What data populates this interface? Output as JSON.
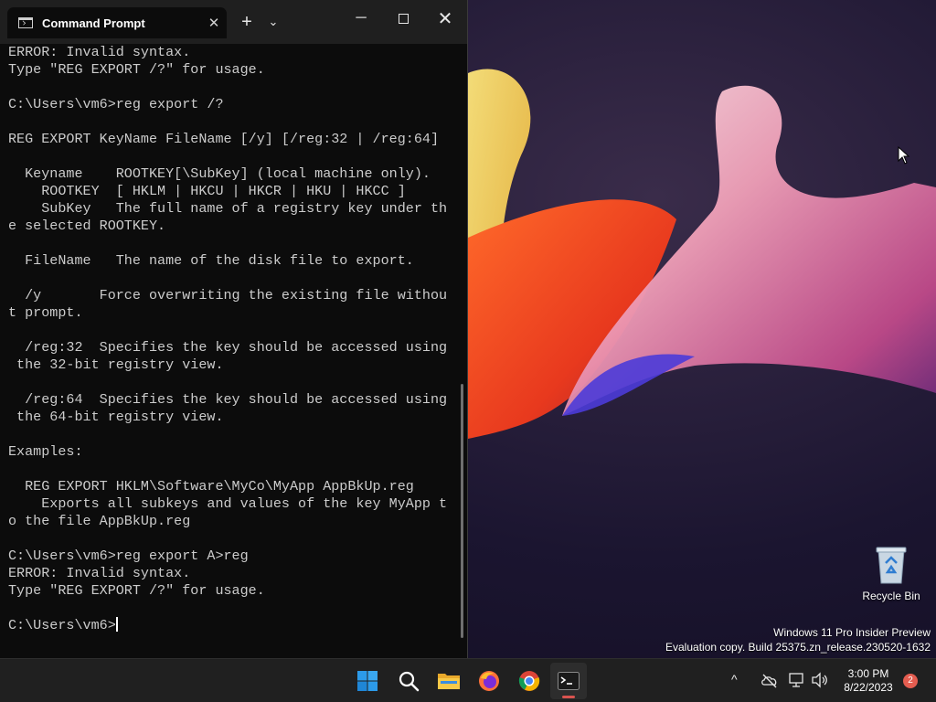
{
  "window": {
    "tab_title": "Command Prompt",
    "tab_close": "✕",
    "new_tab": "+",
    "dropdown": "⌄",
    "minimize": "─",
    "close": "✕"
  },
  "console_lines": [
    "ERROR: Invalid syntax.",
    "Type \"REG EXPORT /?\" for usage.",
    "",
    "C:\\Users\\vm6>reg export /?",
    "",
    "REG EXPORT KeyName FileName [/y] [/reg:32 | /reg:64]",
    "",
    "  Keyname    ROOTKEY[\\SubKey] (local machine only).",
    "    ROOTKEY  [ HKLM | HKCU | HKCR | HKU | HKCC ]",
    "    SubKey   The full name of a registry key under th",
    "e selected ROOTKEY.",
    "",
    "  FileName   The name of the disk file to export.",
    "",
    "  /y       Force overwriting the existing file withou",
    "t prompt.",
    "",
    "  /reg:32  Specifies the key should be accessed using",
    " the 32-bit registry view.",
    "",
    "  /reg:64  Specifies the key should be accessed using",
    " the 64-bit registry view.",
    "",
    "Examples:",
    "",
    "  REG EXPORT HKLM\\Software\\MyCo\\MyApp AppBkUp.reg",
    "    Exports all subkeys and values of the key MyApp t",
    "o the file AppBkUp.reg",
    "",
    "C:\\Users\\vm6>reg export A>reg",
    "ERROR: Invalid syntax.",
    "Type \"REG EXPORT /?\" for usage.",
    "",
    "C:\\Users\\vm6>"
  ],
  "desktop": {
    "recycle_bin_label": "Recycle Bin",
    "watermark_line1": "Windows 11 Pro Insider Preview",
    "watermark_line2": "Evaluation copy. Build 25375.zn_release.230520-1632"
  },
  "taskbar": {
    "apps": [
      {
        "name": "start",
        "icon": "windows-logo-icon"
      },
      {
        "name": "search",
        "icon": "search-icon"
      },
      {
        "name": "file-explorer",
        "icon": "folder-icon"
      },
      {
        "name": "firefox",
        "icon": "firefox-icon"
      },
      {
        "name": "chrome",
        "icon": "chrome-icon"
      },
      {
        "name": "terminal",
        "icon": "terminal-icon",
        "active": true
      }
    ],
    "tray_chevron": "^",
    "time": "3:00 PM",
    "date": "8/22/2023",
    "notification_count": "2"
  },
  "colors": {
    "console_bg": "#0c0c0c",
    "console_fg": "#cccccc",
    "taskbar_bg": "#202020",
    "accent_red": "#e45d50"
  }
}
